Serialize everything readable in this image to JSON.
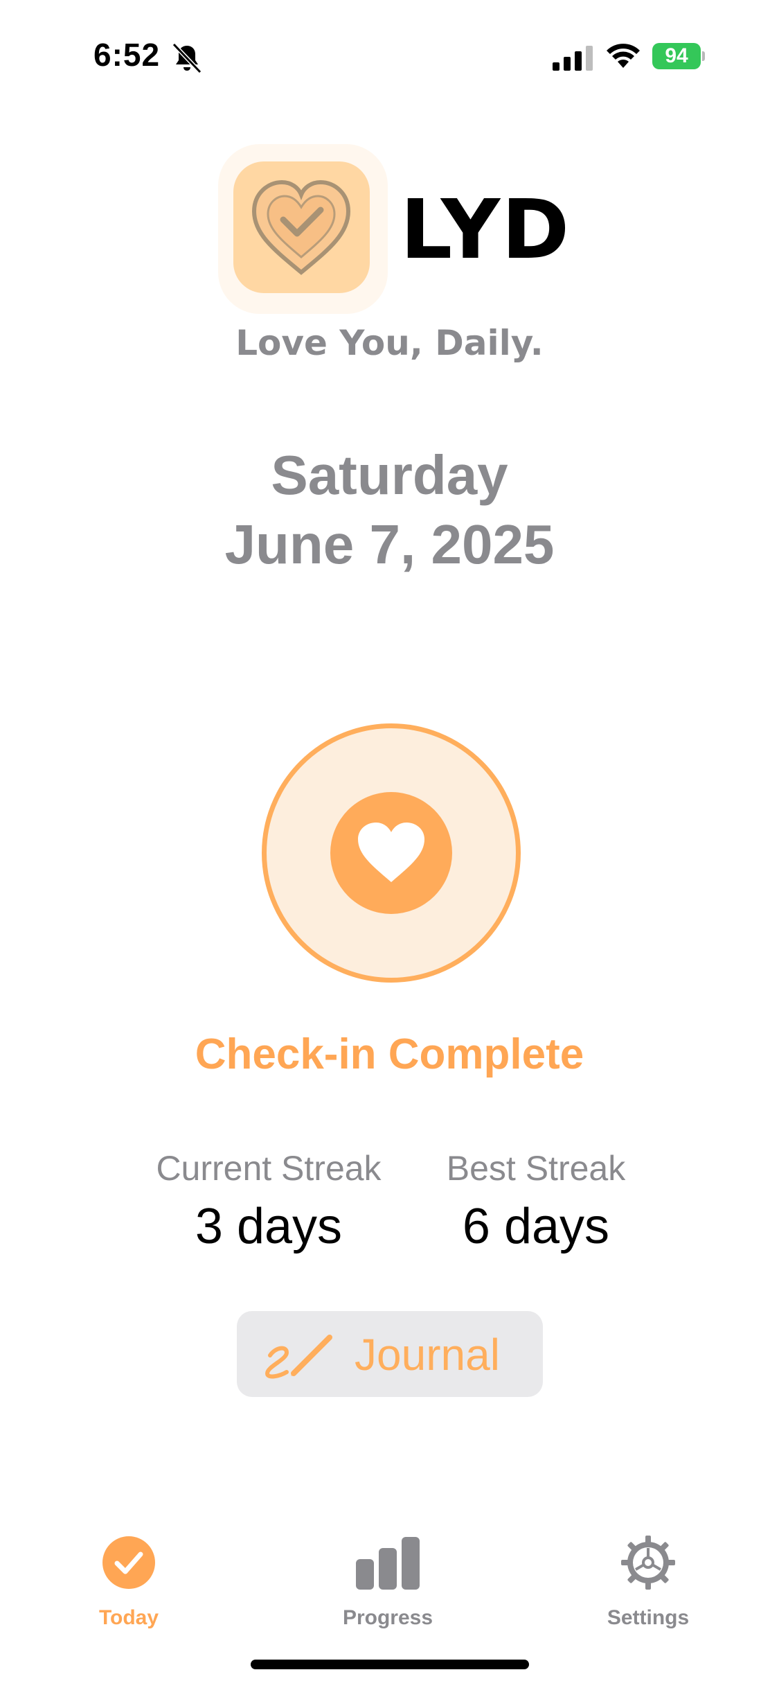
{
  "status_bar": {
    "time": "6:52",
    "battery": "94"
  },
  "header": {
    "app_name": "LYD",
    "tagline": "Love You, Daily."
  },
  "date": {
    "weekday": "Saturday",
    "full_date": "June 7, 2025"
  },
  "checkin": {
    "status_label": "Check-in Complete"
  },
  "streaks": {
    "current": {
      "label": "Current Streak",
      "value": "3 days"
    },
    "best": {
      "label": "Best Streak",
      "value": "6 days"
    }
  },
  "journal_button": {
    "label": "Journal"
  },
  "tab_bar": {
    "today": "Today",
    "progress": "Progress",
    "settings": "Settings",
    "active": "Today"
  },
  "colors": {
    "accent": "#FFA654",
    "ring_fill": "#FDEEDD",
    "secondary_text": "#8A8A8E",
    "battery": "#34C759"
  },
  "icons": {
    "status": [
      "bell-slash-icon",
      "signal-icon",
      "wifi-icon",
      "battery-icon"
    ],
    "app": "heart-check-icon",
    "checkin": "heart-icon",
    "journal": "signature-pencil-icon",
    "tabs": [
      "checkmark-circle-icon",
      "bar-chart-icon",
      "gear-icon"
    ]
  }
}
